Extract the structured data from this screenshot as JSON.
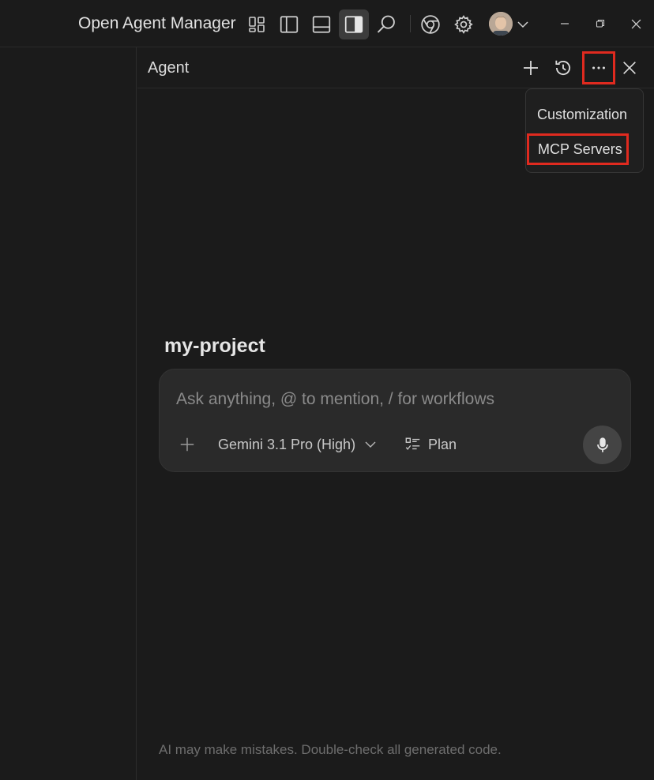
{
  "window": {
    "title": "Open Agent Manager"
  },
  "titlebar": {
    "icons": [
      "layout-grid-icon",
      "sidebar-left-icon",
      "panel-bottom-icon",
      "sidebar-right-icon",
      "search-icon",
      "chrome-icon",
      "gear-icon",
      "avatar",
      "chevron-down-icon"
    ],
    "window_controls": [
      "minimize-icon",
      "restore-icon",
      "close-icon"
    ]
  },
  "agent_panel": {
    "title": "Agent",
    "header_icons": [
      "plus-icon",
      "history-icon",
      "more-icon",
      "close-icon"
    ]
  },
  "menu": {
    "items": [
      {
        "label": "Customization"
      },
      {
        "label": "MCP Servers"
      }
    ]
  },
  "project": {
    "name": "my-project"
  },
  "composer": {
    "placeholder": "Ask anything, @ to mention, / for workflows",
    "model": "Gemini 3.1 Pro (High)",
    "mode": "Plan"
  },
  "footer": {
    "note": "AI may make mistakes. Double-check all generated code."
  },
  "colors": {
    "background": "#1b1b1b",
    "input_background": "#2a2a2a",
    "highlight": "#e02a1f"
  }
}
